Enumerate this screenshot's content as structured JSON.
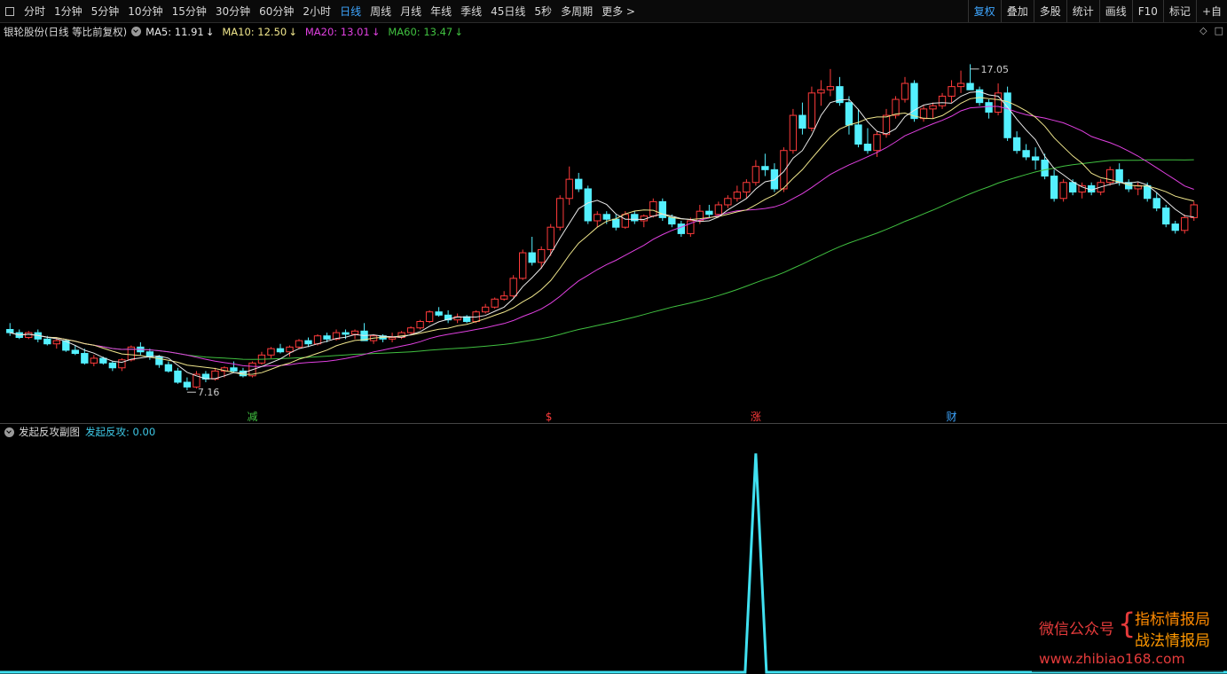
{
  "toolbar": {
    "periods": [
      "分时",
      "1分钟",
      "5分钟",
      "10分钟",
      "15分钟",
      "30分钟",
      "60分钟",
      "2小时",
      "日线",
      "周线",
      "月线",
      "年线",
      "季线",
      "45日线",
      "5秒",
      "多周期",
      "更多 >"
    ],
    "active_period": "日线",
    "right_tools": [
      "复权",
      "叠加",
      "多股",
      "统计",
      "画线",
      "F10",
      "标记",
      "+自"
    ],
    "active_tool": "复权"
  },
  "main_header": {
    "stock_title": "银轮股份(日线 等比前复权)",
    "ma": [
      {
        "label": "MA5: 11.91",
        "arrow": "↓",
        "color": "#e8e8e8"
      },
      {
        "label": "MA10: 12.50",
        "arrow": "↓",
        "color": "#f0e68c"
      },
      {
        "label": "MA20: 13.01",
        "arrow": "↓",
        "color": "#e040e0"
      },
      {
        "label": "MA60: 13.47",
        "arrow": "↓",
        "color": "#40c040"
      }
    ],
    "icons": [
      "◇",
      "□"
    ]
  },
  "chart_data": [
    {
      "type": "candlestick",
      "title": "",
      "price_range": [
        6.5,
        17.6
      ],
      "annotations": {
        "high_label": "17.05",
        "high_value": 17.05,
        "low_label": "7.16",
        "low_value": 7.16
      },
      "up_color": "#ff3b3b",
      "down_color": "#54f0ff",
      "ma_colors": {
        "ma5": "#e8e8e8",
        "ma10": "#f0e68c",
        "ma20": "#e040e0",
        "ma60": "#40c040"
      },
      "markers": [
        {
          "text": "减",
          "color": "#40c040",
          "index": 26
        },
        {
          "text": "$",
          "color": "#ff3b3b",
          "index": 58
        },
        {
          "text": "涨",
          "color": "#ff3b3b",
          "index": 80
        },
        {
          "text": "财",
          "color": "#3ea6ff",
          "index": 101
        }
      ],
      "ohlc": [
        [
          8.9,
          9.1,
          8.7,
          8.8
        ],
        [
          8.8,
          8.9,
          8.6,
          8.65
        ],
        [
          8.65,
          8.85,
          8.6,
          8.8
        ],
        [
          8.8,
          8.9,
          8.5,
          8.6
        ],
        [
          8.6,
          8.7,
          8.4,
          8.45
        ],
        [
          8.45,
          8.6,
          8.3,
          8.55
        ],
        [
          8.55,
          8.6,
          8.2,
          8.25
        ],
        [
          8.25,
          8.4,
          8.1,
          8.15
        ],
        [
          8.15,
          8.3,
          7.8,
          7.85
        ],
        [
          7.85,
          8.1,
          7.75,
          8.0
        ],
        [
          8.0,
          8.05,
          7.8,
          7.85
        ],
        [
          7.85,
          7.9,
          7.6,
          7.7
        ],
        [
          7.7,
          8.0,
          7.6,
          7.95
        ],
        [
          7.95,
          8.4,
          7.9,
          8.35
        ],
        [
          8.35,
          8.5,
          8.1,
          8.2
        ],
        [
          8.2,
          8.3,
          7.95,
          8.05
        ],
        [
          8.05,
          8.1,
          7.7,
          7.8
        ],
        [
          7.8,
          7.9,
          7.55,
          7.6
        ],
        [
          7.6,
          7.7,
          7.2,
          7.25
        ],
        [
          7.25,
          7.4,
          7.0,
          7.1
        ],
        [
          7.1,
          7.6,
          7.05,
          7.5
        ],
        [
          7.5,
          7.6,
          7.25,
          7.35
        ],
        [
          7.35,
          7.7,
          7.3,
          7.6
        ],
        [
          7.6,
          7.75,
          7.4,
          7.7
        ],
        [
          7.7,
          7.9,
          7.55,
          7.6
        ],
        [
          7.6,
          7.7,
          7.4,
          7.45
        ],
        [
          7.45,
          7.9,
          7.4,
          7.85
        ],
        [
          7.85,
          8.2,
          7.8,
          8.1
        ],
        [
          8.1,
          8.35,
          8.0,
          8.3
        ],
        [
          8.3,
          8.45,
          8.15,
          8.2
        ],
        [
          8.2,
          8.4,
          8.05,
          8.35
        ],
        [
          8.35,
          8.6,
          8.3,
          8.55
        ],
        [
          8.55,
          8.65,
          8.35,
          8.45
        ],
        [
          8.45,
          8.75,
          8.4,
          8.7
        ],
        [
          8.7,
          8.8,
          8.5,
          8.6
        ],
        [
          8.6,
          8.9,
          8.55,
          8.8
        ],
        [
          8.8,
          8.9,
          8.6,
          8.75
        ],
        [
          8.75,
          8.9,
          8.6,
          8.85
        ],
        [
          8.85,
          9.1,
          8.8,
          8.55
        ],
        [
          8.55,
          8.75,
          8.45,
          8.7
        ],
        [
          8.7,
          8.75,
          8.5,
          8.6
        ],
        [
          8.6,
          8.8,
          8.5,
          8.65
        ],
        [
          8.65,
          8.85,
          8.6,
          8.8
        ],
        [
          8.8,
          9.0,
          8.75,
          8.95
        ],
        [
          8.95,
          9.2,
          8.9,
          9.15
        ],
        [
          9.15,
          9.5,
          9.1,
          9.45
        ],
        [
          9.45,
          9.6,
          9.3,
          9.35
        ],
        [
          9.35,
          9.5,
          9.1,
          9.2
        ],
        [
          9.2,
          9.4,
          9.1,
          9.3
        ],
        [
          9.3,
          9.35,
          9.1,
          9.15
        ],
        [
          9.15,
          9.5,
          9.1,
          9.45
        ],
        [
          9.45,
          9.7,
          9.4,
          9.6
        ],
        [
          9.6,
          9.9,
          9.55,
          9.85
        ],
        [
          9.85,
          10.1,
          9.8,
          9.95
        ],
        [
          9.95,
          10.6,
          9.9,
          10.5
        ],
        [
          10.5,
          11.4,
          10.45,
          11.3
        ],
        [
          11.3,
          11.8,
          10.9,
          11.0
        ],
        [
          11.0,
          11.5,
          10.8,
          11.4
        ],
        [
          11.4,
          12.2,
          11.2,
          12.1
        ],
        [
          12.1,
          13.1,
          12.0,
          13.0
        ],
        [
          13.0,
          14.0,
          12.8,
          13.6
        ],
        [
          13.6,
          13.8,
          13.2,
          13.3
        ],
        [
          13.3,
          13.4,
          12.2,
          12.3
        ],
        [
          12.3,
          12.6,
          12.1,
          12.5
        ],
        [
          12.5,
          12.6,
          12.2,
          12.35
        ],
        [
          12.35,
          12.5,
          12.0,
          12.1
        ],
        [
          12.1,
          12.6,
          12.05,
          12.5
        ],
        [
          12.5,
          12.6,
          12.2,
          12.3
        ],
        [
          12.3,
          12.5,
          12.1,
          12.45
        ],
        [
          12.45,
          13.0,
          12.4,
          12.9
        ],
        [
          12.9,
          13.0,
          12.3,
          12.4
        ],
        [
          12.4,
          12.5,
          12.1,
          12.2
        ],
        [
          12.2,
          12.3,
          11.8,
          11.9
        ],
        [
          11.9,
          12.4,
          11.8,
          12.3
        ],
        [
          12.3,
          12.8,
          12.2,
          12.6
        ],
        [
          12.6,
          12.8,
          12.4,
          12.5
        ],
        [
          12.5,
          12.9,
          12.4,
          12.8
        ],
        [
          12.8,
          13.1,
          12.7,
          13.0
        ],
        [
          13.0,
          13.4,
          12.9,
          13.2
        ],
        [
          13.2,
          13.6,
          13.0,
          13.5
        ],
        [
          13.5,
          14.2,
          13.4,
          14.0
        ],
        [
          14.0,
          14.4,
          13.7,
          13.9
        ],
        [
          13.9,
          14.1,
          13.2,
          13.3
        ],
        [
          13.3,
          14.6,
          13.2,
          14.5
        ],
        [
          14.5,
          15.8,
          14.4,
          15.6
        ],
        [
          15.6,
          16.0,
          15.0,
          15.2
        ],
        [
          15.2,
          16.5,
          15.1,
          16.3
        ],
        [
          16.3,
          16.7,
          15.9,
          16.4
        ],
        [
          16.4,
          17.05,
          16.2,
          16.5
        ],
        [
          16.5,
          16.8,
          15.9,
          16.0
        ],
        [
          16.0,
          16.2,
          15.0,
          15.3
        ],
        [
          15.3,
          15.8,
          14.6,
          14.7
        ],
        [
          14.7,
          15.2,
          14.4,
          14.5
        ],
        [
          14.5,
          15.1,
          14.3,
          15.0
        ],
        [
          15.0,
          15.8,
          14.9,
          15.6
        ],
        [
          15.6,
          16.2,
          15.5,
          16.1
        ],
        [
          16.1,
          16.8,
          16.0,
          16.6
        ],
        [
          16.6,
          16.7,
          15.4,
          15.5
        ],
        [
          15.5,
          15.9,
          15.4,
          15.8
        ],
        [
          15.8,
          16.0,
          15.5,
          15.9
        ],
        [
          15.9,
          16.3,
          15.8,
          16.2
        ],
        [
          16.2,
          16.7,
          16.0,
          16.5
        ],
        [
          16.5,
          17.0,
          16.3,
          16.6
        ],
        [
          16.6,
          17.2,
          16.5,
          16.4
        ],
        [
          16.4,
          16.5,
          15.9,
          16.0
        ],
        [
          16.0,
          16.1,
          15.5,
          15.7
        ],
        [
          15.7,
          16.6,
          15.6,
          16.3
        ],
        [
          16.3,
          16.5,
          14.8,
          14.9
        ],
        [
          14.9,
          15.1,
          14.4,
          14.5
        ],
        [
          14.5,
          14.7,
          14.2,
          14.3
        ],
        [
          14.3,
          14.6,
          13.9,
          14.2
        ],
        [
          14.2,
          14.4,
          13.6,
          13.7
        ],
        [
          13.7,
          13.9,
          12.9,
          13.0
        ],
        [
          13.0,
          13.6,
          12.9,
          13.5
        ],
        [
          13.5,
          13.6,
          13.1,
          13.2
        ],
        [
          13.2,
          13.5,
          13.0,
          13.4
        ],
        [
          13.4,
          13.5,
          13.1,
          13.2
        ],
        [
          13.2,
          13.6,
          13.1,
          13.5
        ],
        [
          13.5,
          14.0,
          13.4,
          13.9
        ],
        [
          13.9,
          14.1,
          13.4,
          13.5
        ],
        [
          13.5,
          13.6,
          13.2,
          13.3
        ],
        [
          13.3,
          13.5,
          13.1,
          13.4
        ],
        [
          13.4,
          13.5,
          12.9,
          13.0
        ],
        [
          13.0,
          13.2,
          12.6,
          12.7
        ],
        [
          12.7,
          12.8,
          12.1,
          12.2
        ],
        [
          12.2,
          12.3,
          11.9,
          12.0
        ],
        [
          12.0,
          12.5,
          11.9,
          12.4
        ],
        [
          12.4,
          12.9,
          12.3,
          12.8
        ]
      ]
    },
    {
      "type": "line",
      "title": "",
      "series": [
        {
          "name": "发起反攻",
          "color": "#40e0f0"
        }
      ],
      "spike_index": 80,
      "spike_value": 1,
      "ylim": [
        0,
        1.05
      ]
    }
  ],
  "sub_header": {
    "indicator_name": "发起反攻副图",
    "value_label": "发起反攻: 0.00"
  },
  "watermark": {
    "left_text": "微信公众号",
    "brace": "{",
    "right_line1": "指标情报局",
    "right_line2": "战法情报局",
    "url": "www.zhibiao168.com"
  }
}
